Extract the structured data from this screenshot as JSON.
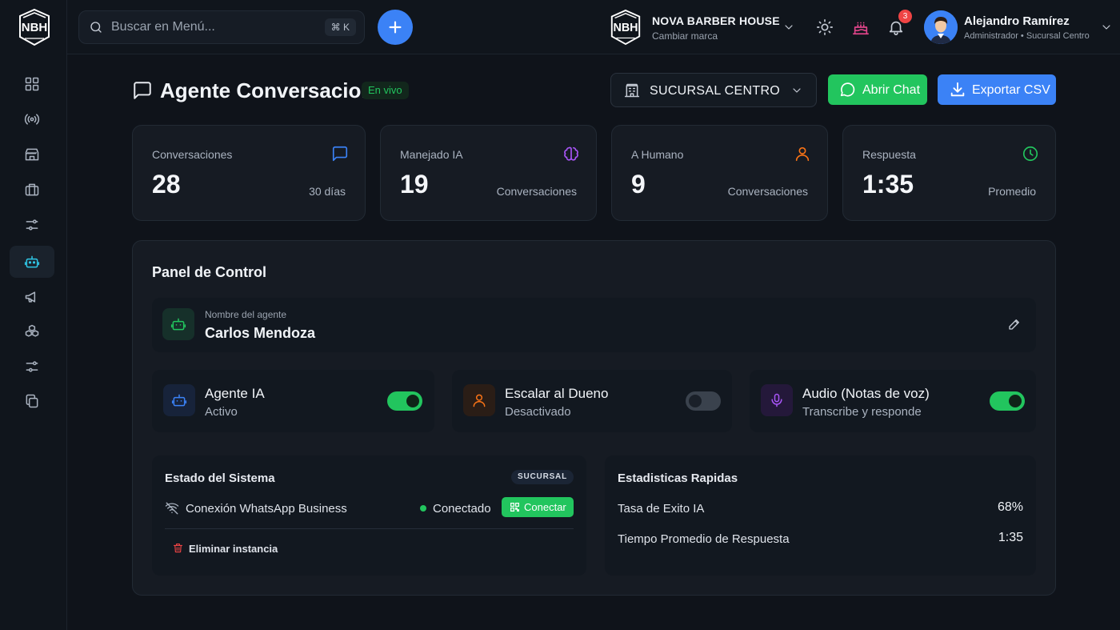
{
  "logo_text": "NBH",
  "search": {
    "placeholder": "Buscar en Menú...",
    "shortcut": "⌘ K"
  },
  "brand": {
    "name": "NOVA BARBER HOUSE",
    "subtitle": "Cambiar marca",
    "logo_text": "NBH"
  },
  "notifications": {
    "count": "3"
  },
  "user": {
    "name": "Alejandro Ramírez",
    "role": "Administrador • Sucursal Centro"
  },
  "sidebar": {
    "items": [
      {
        "icon": "dashboard-grid-icon"
      },
      {
        "icon": "broadcast-icon"
      },
      {
        "icon": "store-icon"
      },
      {
        "icon": "briefcase-icon"
      },
      {
        "icon": "sliders-icon"
      },
      {
        "icon": "robot-icon",
        "active": true
      },
      {
        "icon": "megaphone-icon"
      },
      {
        "icon": "boxes-icon"
      },
      {
        "icon": "sliders-icon"
      },
      {
        "icon": "copy-icon"
      }
    ]
  },
  "page": {
    "title": "Agente Conversacion",
    "live_badge": "En vivo",
    "branch_select": "SUCURSAL CENTRO",
    "chat_button": "Abrir Chat",
    "export_button": "Exportar CSV"
  },
  "stats": [
    {
      "label": "Conversaciones",
      "value": "28",
      "sub": "30 días",
      "icon": "message-square-icon",
      "color": "#3b82f6"
    },
    {
      "label": "Manejado IA",
      "value": "19",
      "sub": "Conversaciones",
      "icon": "brain-icon",
      "color": "#a855f7"
    },
    {
      "label": "A Humano",
      "value": "9",
      "sub": "Conversaciones",
      "icon": "user-icon",
      "color": "#f97316"
    },
    {
      "label": "Respuesta",
      "value": "1:35",
      "sub": "Promedio",
      "icon": "clock-icon",
      "color": "#22c55e"
    }
  ],
  "panel": {
    "title": "Panel de Control",
    "agent": {
      "label": "Nombre del agente",
      "name": "Carlos Mendoza"
    },
    "toggles": [
      {
        "title": "Agente IA",
        "status": "Activo",
        "on": true,
        "icon": "robot-icon",
        "color": "#3b82f6"
      },
      {
        "title": "Escalar al Dueno",
        "status": "Desactivado",
        "on": false,
        "icon": "user-icon",
        "color": "#f97316"
      },
      {
        "title": "Audio (Notas de voz)",
        "status": "Transcribe y responde",
        "on": true,
        "icon": "microphone-icon",
        "color": "#a855f7"
      }
    ],
    "system": {
      "title": "Estado del Sistema",
      "badge": "SUCURSAL",
      "connection_label": "Conexión WhatsApp Business",
      "connection_status": "Conectado",
      "connect_button": "Conectar",
      "delete_label": "Eliminar instancia"
    },
    "quick_stats": {
      "title": "Estadisticas Rapidas",
      "rows": [
        {
          "label": "Tasa de Exito IA",
          "value": "68%"
        },
        {
          "label": "Tiempo Promedio de Respuesta",
          "value": "1:35"
        }
      ]
    }
  },
  "colors": {
    "accent_blue": "#3b82f6",
    "accent_green": "#22c55e",
    "accent_cyan": "#2fc7e6",
    "danger": "#ef4444"
  }
}
